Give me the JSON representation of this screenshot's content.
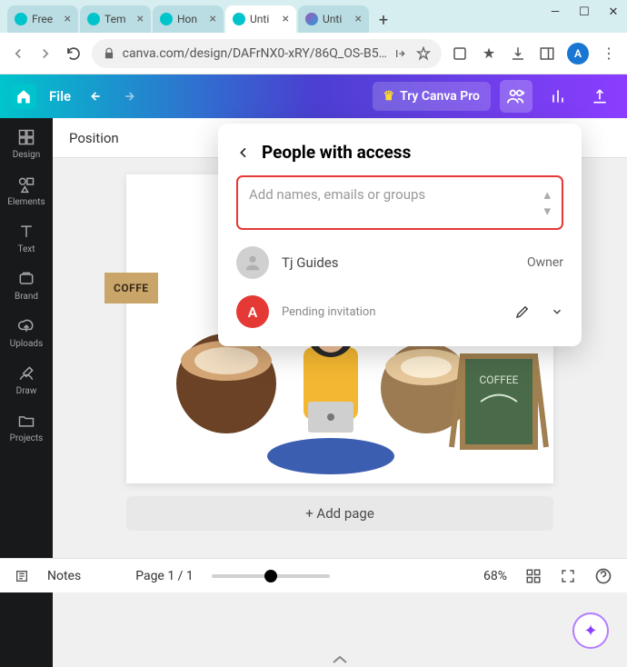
{
  "browser": {
    "tabs": [
      {
        "title": "Free"
      },
      {
        "title": "Tem"
      },
      {
        "title": "Hon"
      },
      {
        "title": "Unti",
        "active": true
      },
      {
        "title": "Unti",
        "purple": true
      }
    ],
    "url": "canva.com/design/DAFrNX0-xRY/86Q_OS-B5…",
    "avatar": "A"
  },
  "header": {
    "file": "File",
    "try_pro": "Try Canva Pro"
  },
  "sidebar": {
    "items": [
      {
        "label": "Design"
      },
      {
        "label": "Elements"
      },
      {
        "label": "Text"
      },
      {
        "label": "Brand"
      },
      {
        "label": "Uploads"
      },
      {
        "label": "Draw"
      },
      {
        "label": "Projects"
      }
    ]
  },
  "toolbar": {
    "position": "Position"
  },
  "canvas": {
    "coffee_label": "COFFE",
    "board_label": "COFFEE",
    "add_page": "+ Add page"
  },
  "popover": {
    "title": "People with access",
    "placeholder": "Add names, emails or groups",
    "people": [
      {
        "name": "Tj Guides",
        "role": "Owner"
      },
      {
        "initial": "A",
        "sub": "Pending invitation"
      }
    ]
  },
  "footer": {
    "notes": "Notes",
    "page": "Page 1 / 1",
    "zoom": "68%"
  }
}
